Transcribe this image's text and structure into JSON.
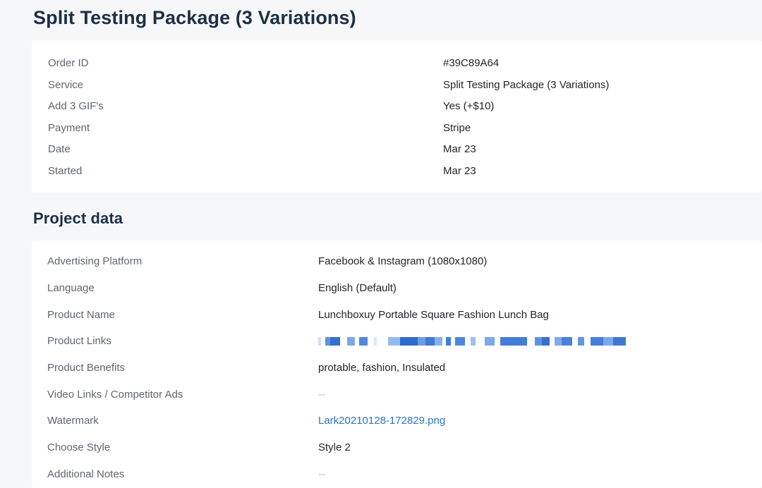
{
  "page": {
    "title": "Split Testing Package (3 Variations)"
  },
  "order": {
    "rows": [
      {
        "label": "Order ID",
        "value": "#39C89A64"
      },
      {
        "label": "Service",
        "value": "Split Testing Package (3 Variations)"
      },
      {
        "label": "Add 3 GIF's",
        "value": "Yes (+$10)"
      },
      {
        "label": "Payment",
        "value": "Stripe"
      },
      {
        "label": "Date",
        "value": "Mar 23"
      },
      {
        "label": "Started",
        "value": "Mar 23"
      }
    ]
  },
  "project": {
    "title": "Project data",
    "rows": [
      {
        "label": "Advertising Platform",
        "value": "Facebook & Instagram (1080x1080)"
      },
      {
        "label": "Language",
        "value": "English (Default)"
      },
      {
        "label": "Product Name",
        "value": "Lunchboxuy Portable Square Fashion Lunch Bag"
      },
      {
        "label": "Product Links",
        "value": ""
      },
      {
        "label": "Product Benefits",
        "value": "protable, fashion, Insulated"
      },
      {
        "label": "Video Links / Competitor Ads",
        "value": "--"
      },
      {
        "label": "Watermark",
        "value": "Lark20210128-172829.png"
      },
      {
        "label": "Choose Style",
        "value": "Style 2"
      },
      {
        "label": "Additional Notes",
        "value": "--"
      }
    ]
  },
  "colors": {
    "background": "#f6f7f9",
    "card": "#ffffff",
    "title": "#1c2f45",
    "label": "#5f6670",
    "value": "#1f2328",
    "link": "#2d74c8",
    "muted": "#b8bec6"
  }
}
